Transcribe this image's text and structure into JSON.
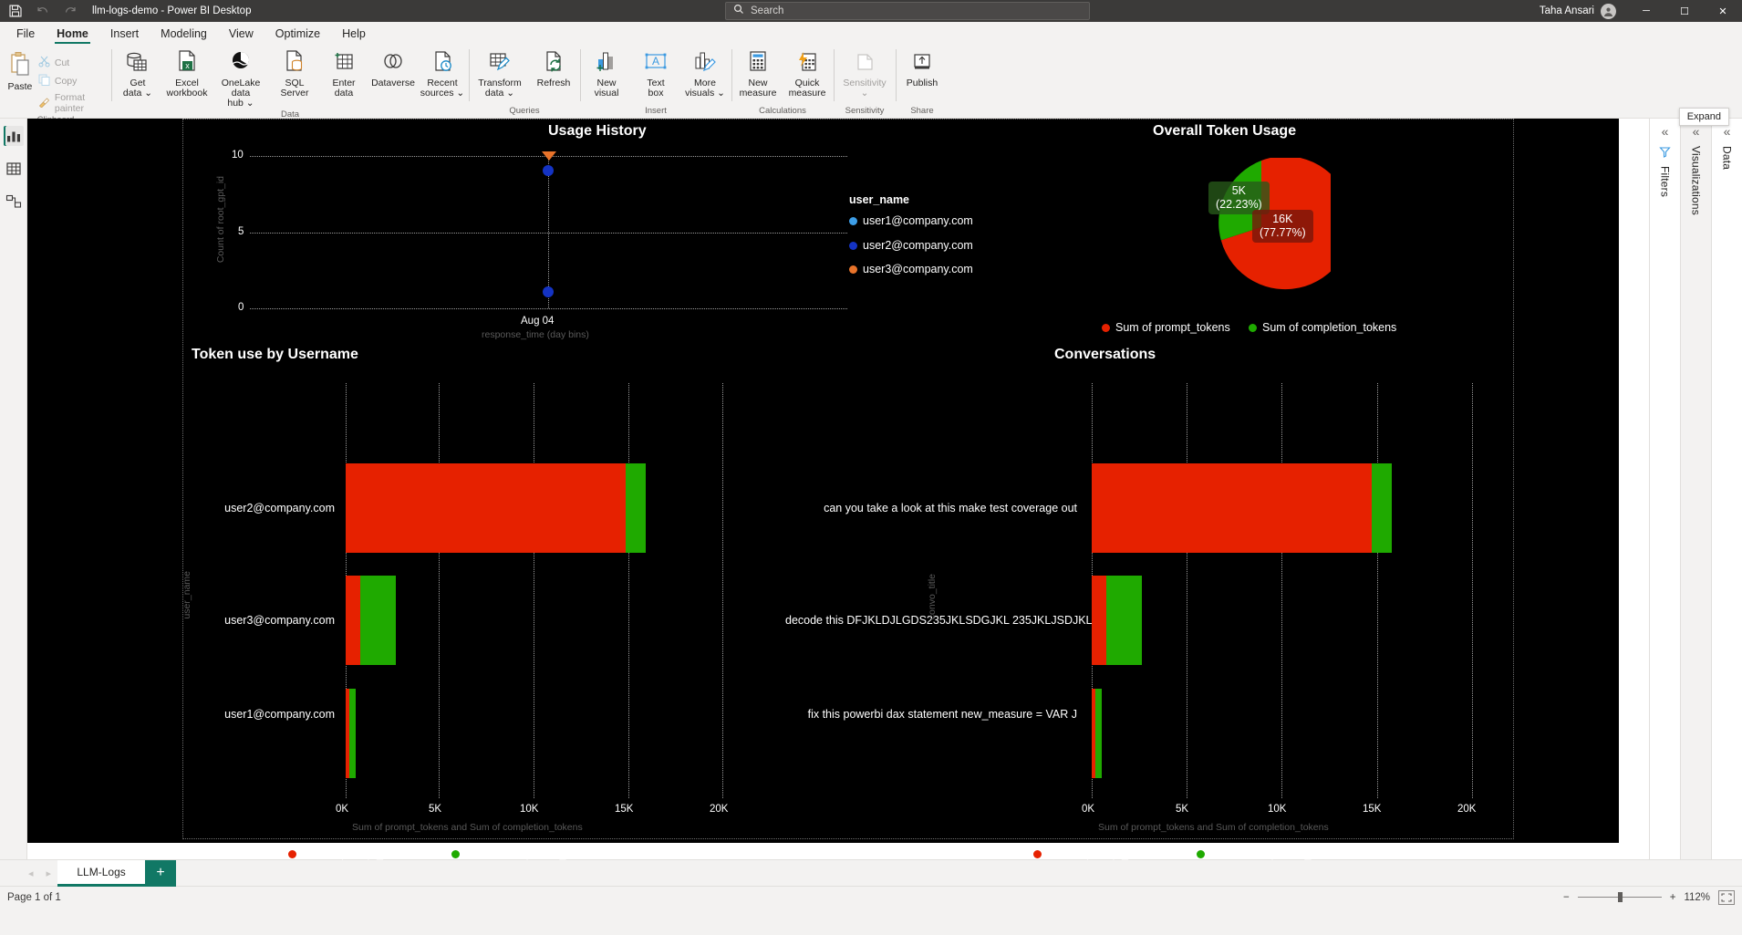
{
  "titlebar": {
    "title": "llm-logs-demo - Power BI Desktop",
    "save_icon": "save-icon",
    "undo_icon": "undo-icon",
    "redo_icon": "redo-icon",
    "search_placeholder": "Search",
    "search_icon": "search-icon",
    "user_name": "Taha Ansari",
    "minimize": "─",
    "maximize": "☐",
    "close": "✕"
  },
  "ribbon": {
    "tabs": [
      "File",
      "Home",
      "Insert",
      "Modeling",
      "View",
      "Optimize",
      "Help"
    ],
    "active_tab": "Home",
    "groups": [
      {
        "label": "Clipboard",
        "paste": "Paste",
        "items": [
          "Cut",
          "Copy",
          "Format painter"
        ]
      },
      {
        "label": "Data",
        "items": [
          "Get\ndata ⌄",
          "Excel\nworkbook",
          "OneLake data\nhub ⌄",
          "SQL\nServer",
          "Enter\ndata",
          "Dataverse",
          "Recent\nsources ⌄"
        ]
      },
      {
        "label": "Queries",
        "items": [
          "Transform\ndata ⌄",
          "Refresh"
        ]
      },
      {
        "label": "Insert",
        "items": [
          "New\nvisual",
          "Text\nbox",
          "More\nvisuals ⌄"
        ]
      },
      {
        "label": "Calculations",
        "items": [
          "New\nmeasure",
          "Quick\nmeasure"
        ]
      },
      {
        "label": "Sensitivity",
        "items": [
          "Sensitivity\n⌄"
        ]
      },
      {
        "label": "Share",
        "items": [
          "Publish"
        ]
      }
    ],
    "tooltip": "Expand"
  },
  "left_rail": [
    {
      "name": "report-view-icon",
      "selected": true
    },
    {
      "name": "table-view-icon",
      "selected": false
    },
    {
      "name": "model-view-icon",
      "selected": false
    }
  ],
  "side_panels": [
    {
      "label": "Filters",
      "icon": "filter-icon",
      "collapse": "«"
    },
    {
      "label": "Visualizations",
      "icon": "",
      "collapse": "«"
    },
    {
      "label": "Data",
      "icon": "",
      "collapse": "«"
    }
  ],
  "footer": {
    "prev_arrow": "◂",
    "next_arrow": "▸",
    "page_tab": "LLM-Logs",
    "add_page": "+",
    "page_status": "Page 1 of 1",
    "zoom_minus": "−",
    "zoom_plus": "+",
    "zoom_level": "112%",
    "fit_icon": "fit-to-page-icon"
  },
  "colors": {
    "red": "#e62100",
    "green": "#1faa00",
    "light_blue": "#3d9ee8",
    "dark_blue": "#1433c4",
    "orange": "#e8732a",
    "accent": "#117865",
    "canvas": "#000000"
  },
  "chart_data": [
    {
      "id": "usage-history",
      "type": "scatter",
      "title": "Usage History",
      "xlabel": "response_time (day bins)",
      "ylabel": "Count of root_gpt_id",
      "ylim": [
        0,
        10
      ],
      "yticks": [
        "0",
        "5",
        "10"
      ],
      "xticks": [
        "Aug 04"
      ],
      "grid": true,
      "legend_title": "user_name",
      "legend_position": "right",
      "series": [
        {
          "name": "user1@company.com",
          "color": "#3d9ee8",
          "points": [
            {
              "x": "Aug 04",
              "y": 0
            }
          ]
        },
        {
          "name": "user2@company.com",
          "color": "#1433c4",
          "points": [
            {
              "x": "Aug 04",
              "y": 9
            }
          ]
        },
        {
          "name": "user3@company.com",
          "color": "#e8732a",
          "points": [
            {
              "x": "Aug 04",
              "y": 10
            }
          ]
        }
      ]
    },
    {
      "id": "overall-token-usage",
      "type": "pie",
      "title": "Overall Token Usage",
      "legend_position": "bottom",
      "slices": [
        {
          "name": "Sum of prompt_tokens",
          "value": 16000,
          "label": "16K",
          "percent": "(77.77%)",
          "color": "#e62100"
        },
        {
          "name": "Sum of completion_tokens",
          "value": 5000,
          "label": "5K",
          "percent": "(22.23%)",
          "color": "#1faa00"
        }
      ]
    },
    {
      "id": "token-use-by-username",
      "type": "bar",
      "title": "Token use by Username",
      "orientation": "horizontal",
      "stacked": true,
      "ylabel": "user_name",
      "xlabel": "Sum of prompt_tokens and Sum of completion_tokens",
      "xticks": [
        "0K",
        "5K",
        "10K",
        "15K",
        "20K"
      ],
      "xlim": [
        0,
        20000
      ],
      "categories": [
        "user2@company.com",
        "user3@company.com",
        "user1@company.com"
      ],
      "series": [
        {
          "name": "Sum of prompt_tokens",
          "color": "#e62100",
          "values": [
            14800,
            770,
            150
          ]
        },
        {
          "name": "Sum of completion_tokens",
          "color": "#1faa00",
          "values": [
            1060,
            1880,
            320
          ]
        }
      ]
    },
    {
      "id": "conversations",
      "type": "bar",
      "title": "Conversations",
      "orientation": "horizontal",
      "stacked": true,
      "ylabel": "convo_title",
      "xlabel": "Sum of prompt_tokens and Sum of completion_tokens",
      "xticks": [
        "0K",
        "5K",
        "10K",
        "15K",
        "20K"
      ],
      "xlim": [
        0,
        20000
      ],
      "categories": [
        "can you take a look at this make test coverage out",
        "decode this DFJKLDJLGDS235JKLSDGJKL 235JKLJSDJKL",
        "fix this powerbi dax statement new_measure = VAR J"
      ],
      "series": [
        {
          "name": "Sum of prompt_tokens",
          "color": "#e62100",
          "values": [
            14800,
            770,
            150
          ]
        },
        {
          "name": "Sum of completion_tokens",
          "color": "#1faa00",
          "values": [
            1060,
            1880,
            320
          ]
        }
      ]
    }
  ]
}
